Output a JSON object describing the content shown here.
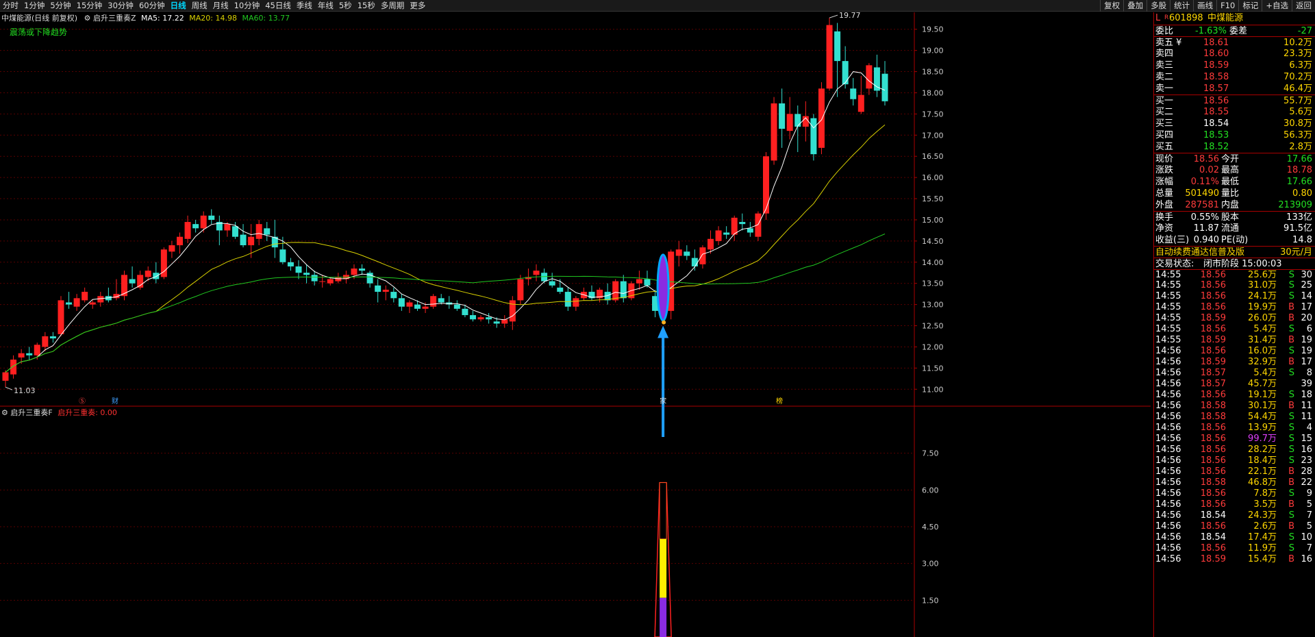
{
  "toolbar": {
    "periods": [
      "分时",
      "1分钟",
      "5分钟",
      "15分钟",
      "30分钟",
      "60分钟",
      "日线",
      "周线",
      "月线",
      "10分钟",
      "45日线",
      "季线",
      "年线",
      "5秒",
      "15秒",
      "多周期",
      "更多"
    ],
    "active": "日线",
    "right_buttons": [
      "复权",
      "叠加",
      "多股",
      "统计",
      "画线",
      "F10",
      "标记",
      "+自选",
      "返回"
    ]
  },
  "main": {
    "stock_label": "中煤能源(日线 前复权)",
    "indicator_name": "启升三重奏Z",
    "ma5": "MA5: 17.22",
    "ma20": "MA20: 14.98",
    "ma60": "MA60: 13.77",
    "trend_text": "震荡或下降趋势",
    "high_label": "19.77",
    "low_label": "11.03",
    "marks": [
      "Ⓢ",
      "财",
      "家",
      "榜"
    ],
    "y_ticks": [
      "19.50",
      "19.00",
      "18.50",
      "18.00",
      "17.50",
      "17.00",
      "16.50",
      "16.00",
      "15.50",
      "15.00",
      "14.50",
      "14.00",
      "13.50",
      "13.00",
      "12.50",
      "12.00",
      "11.50",
      "11.00"
    ]
  },
  "sub": {
    "indicator": "启升三重奏F",
    "value_label": "启升三重奏: 0.00",
    "y_ticks": [
      "7.50",
      "6.00",
      "4.50",
      "3.00",
      "1.50"
    ]
  },
  "colors": {
    "up": "#ff2020",
    "down": "#33e0d0",
    "ma5": "#ffffff",
    "ma20": "#d8d000",
    "ma60": "#20c820",
    "accent": "#00a0ff"
  },
  "chart_data": {
    "type": "candlestick",
    "ylim": [
      10.6,
      19.9
    ],
    "candles": [
      [
        11.2,
        11.45,
        11.05,
        11.4
      ],
      [
        11.35,
        11.8,
        11.25,
        11.7
      ],
      [
        11.75,
        11.95,
        11.6,
        11.85
      ],
      [
        11.85,
        12.0,
        11.7,
        11.8
      ],
      [
        11.8,
        12.1,
        11.7,
        12.05
      ],
      [
        12.0,
        12.35,
        11.9,
        12.25
      ],
      [
        12.25,
        12.35,
        12.1,
        12.2
      ],
      [
        12.3,
        13.2,
        12.25,
        13.1
      ],
      [
        13.05,
        13.3,
        12.9,
        13.0
      ],
      [
        12.95,
        13.25,
        12.85,
        13.15
      ],
      [
        13.1,
        13.4,
        13.05,
        13.3
      ],
      [
        13.0,
        13.1,
        12.9,
        13.05
      ],
      [
        13.05,
        13.3,
        12.95,
        13.2
      ],
      [
        13.2,
        13.4,
        13.05,
        13.1
      ],
      [
        13.15,
        13.6,
        13.1,
        13.25
      ],
      [
        13.2,
        13.8,
        13.1,
        13.7
      ],
      [
        13.6,
        13.9,
        13.4,
        13.5
      ],
      [
        13.4,
        13.8,
        13.35,
        13.7
      ],
      [
        13.65,
        13.9,
        13.55,
        13.8
      ],
      [
        13.75,
        14.0,
        13.5,
        13.6
      ],
      [
        13.65,
        14.35,
        13.6,
        14.3
      ],
      [
        14.25,
        14.5,
        14.1,
        14.4
      ],
      [
        14.4,
        14.7,
        14.2,
        14.6
      ],
      [
        14.55,
        15.1,
        14.45,
        14.95
      ],
      [
        14.9,
        15.0,
        14.7,
        14.8
      ],
      [
        14.8,
        15.2,
        14.7,
        15.1
      ],
      [
        15.1,
        15.25,
        14.9,
        15.0
      ],
      [
        14.95,
        15.1,
        14.4,
        14.75
      ],
      [
        14.75,
        14.95,
        14.6,
        14.9
      ],
      [
        14.85,
        14.95,
        14.55,
        14.6
      ],
      [
        14.65,
        14.9,
        14.35,
        14.4
      ],
      [
        14.4,
        14.9,
        14.1,
        14.6
      ],
      [
        14.55,
        15.0,
        14.4,
        14.9
      ],
      [
        14.8,
        14.95,
        14.5,
        14.65
      ],
      [
        14.6,
        15.0,
        14.1,
        14.35
      ],
      [
        14.3,
        14.6,
        13.95,
        14.0
      ],
      [
        14.0,
        14.1,
        13.8,
        13.9
      ],
      [
        13.9,
        14.05,
        13.6,
        13.75
      ],
      [
        13.75,
        13.95,
        13.5,
        13.7
      ],
      [
        13.7,
        13.8,
        13.45,
        13.55
      ],
      [
        13.55,
        13.7,
        13.4,
        13.55
      ],
      [
        13.5,
        13.65,
        13.45,
        13.6
      ],
      [
        13.55,
        13.75,
        13.5,
        13.65
      ],
      [
        13.6,
        13.8,
        13.5,
        13.7
      ],
      [
        13.7,
        13.95,
        13.6,
        13.85
      ],
      [
        13.85,
        13.95,
        13.7,
        13.8
      ],
      [
        13.75,
        13.8,
        13.4,
        13.5
      ],
      [
        13.45,
        13.6,
        13.05,
        13.3
      ],
      [
        13.3,
        13.45,
        13.1,
        13.35
      ],
      [
        13.3,
        13.4,
        13.05,
        13.15
      ],
      [
        13.15,
        13.25,
        12.85,
        12.95
      ],
      [
        12.95,
        13.1,
        12.8,
        13.05
      ],
      [
        13.0,
        13.1,
        12.85,
        12.9
      ],
      [
        12.9,
        13.05,
        12.8,
        12.95
      ],
      [
        12.95,
        13.25,
        12.9,
        13.2
      ],
      [
        13.15,
        13.25,
        13.0,
        13.05
      ],
      [
        13.05,
        13.2,
        12.9,
        13.0
      ],
      [
        13.0,
        13.1,
        12.85,
        12.9
      ],
      [
        12.9,
        13.0,
        12.7,
        12.75
      ],
      [
        12.75,
        12.85,
        12.6,
        12.65
      ],
      [
        12.65,
        12.75,
        12.6,
        12.7
      ],
      [
        12.7,
        12.8,
        12.55,
        12.65
      ],
      [
        12.6,
        12.7,
        12.45,
        12.55
      ],
      [
        12.55,
        12.75,
        12.45,
        12.65
      ],
      [
        12.6,
        13.2,
        12.4,
        13.1
      ],
      [
        13.1,
        13.7,
        13.0,
        13.6
      ],
      [
        13.6,
        13.85,
        13.45,
        13.65
      ],
      [
        13.7,
        13.95,
        13.55,
        13.8
      ],
      [
        13.75,
        13.85,
        13.5,
        13.55
      ],
      [
        13.55,
        13.75,
        13.4,
        13.45
      ],
      [
        13.4,
        13.6,
        13.25,
        13.3
      ],
      [
        13.3,
        13.4,
        12.85,
        12.95
      ],
      [
        12.95,
        13.2,
        12.85,
        13.15
      ],
      [
        13.15,
        13.4,
        13.1,
        13.3
      ],
      [
        13.3,
        13.45,
        13.1,
        13.15
      ],
      [
        13.15,
        13.4,
        13.05,
        13.35
      ],
      [
        13.3,
        13.5,
        13.0,
        13.1
      ],
      [
        13.1,
        13.6,
        13.05,
        13.55
      ],
      [
        13.55,
        13.7,
        13.05,
        13.15
      ],
      [
        13.15,
        13.55,
        13.1,
        13.5
      ],
      [
        13.5,
        13.8,
        13.35,
        13.6
      ],
      [
        13.6,
        13.8,
        13.4,
        13.45
      ],
      [
        13.2,
        13.35,
        12.7,
        12.85
      ],
      [
        12.85,
        12.95,
        12.65,
        12.85
      ],
      [
        12.85,
        14.3,
        12.65,
        14.25
      ],
      [
        14.15,
        14.5,
        13.9,
        14.3
      ],
      [
        14.25,
        14.4,
        14.05,
        14.15
      ],
      [
        14.1,
        14.3,
        13.8,
        13.9
      ],
      [
        13.95,
        14.4,
        13.85,
        14.35
      ],
      [
        14.3,
        14.75,
        14.2,
        14.55
      ],
      [
        14.5,
        14.85,
        14.4,
        14.75
      ],
      [
        14.7,
        14.85,
        14.55,
        14.65
      ],
      [
        14.65,
        15.1,
        14.5,
        15.05
      ],
      [
        14.95,
        15.15,
        14.75,
        14.9
      ],
      [
        14.8,
        14.95,
        14.6,
        14.7
      ],
      [
        14.6,
        15.2,
        14.5,
        15.15
      ],
      [
        15.15,
        16.6,
        15.0,
        16.5
      ],
      [
        16.4,
        17.9,
        16.3,
        17.75
      ],
      [
        17.75,
        18.1,
        16.7,
        17.15
      ],
      [
        17.1,
        17.9,
        16.9,
        17.5
      ],
      [
        17.5,
        17.7,
        16.6,
        17.2
      ],
      [
        17.2,
        17.8,
        16.85,
        17.45
      ],
      [
        17.4,
        17.5,
        16.4,
        16.55
      ],
      [
        16.7,
        18.25,
        16.55,
        18.1
      ],
      [
        18.1,
        19.77,
        18.05,
        19.6
      ],
      [
        19.45,
        19.65,
        17.9,
        18.75
      ],
      [
        18.75,
        19.1,
        18.1,
        18.2
      ],
      [
        18.1,
        18.35,
        17.7,
        17.85
      ],
      [
        17.55,
        18.4,
        17.5,
        17.95
      ],
      [
        18.1,
        18.7,
        17.95,
        18.65
      ],
      [
        18.6,
        18.9,
        17.9,
        18.05
      ],
      [
        18.45,
        18.75,
        17.7,
        17.8
      ]
    ]
  },
  "panel": {
    "header": {
      "code": "601898",
      "name": "中煤能源",
      "badge": "L",
      "sub_badge": "R"
    },
    "weibi": {
      "label": "委比",
      "value": "-1.63%",
      "label2": "委差",
      "value2": "-27"
    },
    "asks": [
      {
        "label": "卖五 ¥",
        "price": "18.61",
        "vol": "10.2万"
      },
      {
        "label": "卖四",
        "price": "18.60",
        "vol": "23.3万"
      },
      {
        "label": "卖三",
        "price": "18.59",
        "vol": "6.3万"
      },
      {
        "label": "卖二",
        "price": "18.58",
        "vol": "70.2万"
      },
      {
        "label": "卖一",
        "price": "18.57",
        "vol": "46.4万"
      }
    ],
    "bids": [
      {
        "label": "买一",
        "price": "18.56",
        "vol": "55.7万",
        "pc": "red"
      },
      {
        "label": "买二",
        "price": "18.55",
        "vol": "5.6万",
        "pc": "red"
      },
      {
        "label": "买三",
        "price": "18.54",
        "vol": "30.8万",
        "pc": "white"
      },
      {
        "label": "买四",
        "price": "18.53",
        "vol": "56.3万",
        "pc": "green"
      },
      {
        "label": "买五",
        "price": "18.52",
        "vol": "2.8万",
        "pc": "green"
      }
    ],
    "quote": [
      {
        "l1": "现价",
        "v1": "18.56",
        "c1": "red",
        "l2": "今开",
        "v2": "17.66",
        "c2": "green"
      },
      {
        "l1": "涨跌",
        "v1": "0.02",
        "c1": "red",
        "l2": "最高",
        "v2": "18.78",
        "c2": "red"
      },
      {
        "l1": "涨幅",
        "v1": "0.11%",
        "c1": "red",
        "l2": "最低",
        "v2": "17.66",
        "c2": "green"
      },
      {
        "l1": "总量",
        "v1": "501490",
        "c1": "yellow",
        "l2": "量比",
        "v2": "0.80",
        "c2": "yellow"
      },
      {
        "l1": "外盘",
        "v1": "287581",
        "c1": "red",
        "l2": "内盘",
        "v2": "213909",
        "c2": "green"
      }
    ],
    "fund": [
      {
        "l1": "换手",
        "v1": "0.55%",
        "l2": "股本",
        "v2": "133亿"
      },
      {
        "l1": "净资",
        "v1": "11.87",
        "l2": "流通",
        "v2": "91.5亿"
      },
      {
        "l1": "收益(三)",
        "v1": "0.940",
        "l2": "PE(动)",
        "v2": "14.8"
      }
    ],
    "promo": "自动续费通达信普及版",
    "promo_price": "30元/月",
    "status_label": "交易状态:",
    "status_value": "闭市阶段 15:00:03",
    "ticks": [
      {
        "t": "14:55",
        "p": "18.56",
        "pc": "red",
        "v": "25.6万",
        "vc": "yellow",
        "bs": "S",
        "n": "30"
      },
      {
        "t": "14:55",
        "p": "18.56",
        "pc": "red",
        "v": "31.0万",
        "vc": "yellow",
        "bs": "S",
        "n": "25"
      },
      {
        "t": "14:55",
        "p": "18.56",
        "pc": "red",
        "v": "24.1万",
        "vc": "yellow",
        "bs": "S",
        "n": "14"
      },
      {
        "t": "14:55",
        "p": "18.56",
        "pc": "red",
        "v": "19.9万",
        "vc": "yellow",
        "bs": "B",
        "n": "17"
      },
      {
        "t": "14:55",
        "p": "18.59",
        "pc": "red",
        "v": "26.0万",
        "vc": "yellow",
        "bs": "B",
        "n": "20"
      },
      {
        "t": "14:55",
        "p": "18.56",
        "pc": "red",
        "v": "5.4万",
        "vc": "yellow",
        "bs": "S",
        "n": "6"
      },
      {
        "t": "14:55",
        "p": "18.59",
        "pc": "red",
        "v": "31.4万",
        "vc": "yellow",
        "bs": "B",
        "n": "19"
      },
      {
        "t": "14:56",
        "p": "18.56",
        "pc": "red",
        "v": "16.0万",
        "vc": "yellow",
        "bs": "S",
        "n": "19"
      },
      {
        "t": "14:56",
        "p": "18.59",
        "pc": "red",
        "v": "32.9万",
        "vc": "yellow",
        "bs": "B",
        "n": "17"
      },
      {
        "t": "14:56",
        "p": "18.57",
        "pc": "red",
        "v": "5.4万",
        "vc": "yellow",
        "bs": "S",
        "n": "8"
      },
      {
        "t": "14:56",
        "p": "18.57",
        "pc": "red",
        "v": "45.7万",
        "vc": "yellow",
        "bs": "",
        "n": "39"
      },
      {
        "t": "14:56",
        "p": "18.56",
        "pc": "red",
        "v": "19.1万",
        "vc": "yellow",
        "bs": "S",
        "n": "18"
      },
      {
        "t": "14:56",
        "p": "18.58",
        "pc": "red",
        "v": "30.1万",
        "vc": "yellow",
        "bs": "B",
        "n": "11"
      },
      {
        "t": "14:56",
        "p": "18.58",
        "pc": "red",
        "v": "54.4万",
        "vc": "yellow",
        "bs": "S",
        "n": "11"
      },
      {
        "t": "14:56",
        "p": "18.56",
        "pc": "red",
        "v": "13.9万",
        "vc": "yellow",
        "bs": "S",
        "n": "4"
      },
      {
        "t": "14:56",
        "p": "18.56",
        "pc": "red",
        "v": "99.7万",
        "vc": "purple",
        "bs": "S",
        "n": "15"
      },
      {
        "t": "14:56",
        "p": "18.56",
        "pc": "red",
        "v": "28.2万",
        "vc": "yellow",
        "bs": "S",
        "n": "16"
      },
      {
        "t": "14:56",
        "p": "18.56",
        "pc": "red",
        "v": "18.4万",
        "vc": "yellow",
        "bs": "S",
        "n": "23"
      },
      {
        "t": "14:56",
        "p": "18.56",
        "pc": "red",
        "v": "22.1万",
        "vc": "yellow",
        "bs": "B",
        "n": "28"
      },
      {
        "t": "14:56",
        "p": "18.58",
        "pc": "red",
        "v": "46.8万",
        "vc": "yellow",
        "bs": "B",
        "n": "22"
      },
      {
        "t": "14:56",
        "p": "18.56",
        "pc": "red",
        "v": "7.8万",
        "vc": "yellow",
        "bs": "S",
        "n": "9"
      },
      {
        "t": "14:56",
        "p": "18.56",
        "pc": "red",
        "v": "3.5万",
        "vc": "yellow",
        "bs": "B",
        "n": "5"
      },
      {
        "t": "14:56",
        "p": "18.54",
        "pc": "white",
        "v": "24.3万",
        "vc": "yellow",
        "bs": "S",
        "n": "7"
      },
      {
        "t": "14:56",
        "p": "18.56",
        "pc": "red",
        "v": "2.6万",
        "vc": "yellow",
        "bs": "B",
        "n": "5"
      },
      {
        "t": "14:56",
        "p": "18.54",
        "pc": "white",
        "v": "17.4万",
        "vc": "yellow",
        "bs": "S",
        "n": "10"
      },
      {
        "t": "14:56",
        "p": "18.56",
        "pc": "red",
        "v": "11.9万",
        "vc": "yellow",
        "bs": "S",
        "n": "7"
      },
      {
        "t": "14:56",
        "p": "18.59",
        "pc": "red",
        "v": "15.4万",
        "vc": "yellow",
        "bs": "B",
        "n": "16"
      }
    ]
  }
}
